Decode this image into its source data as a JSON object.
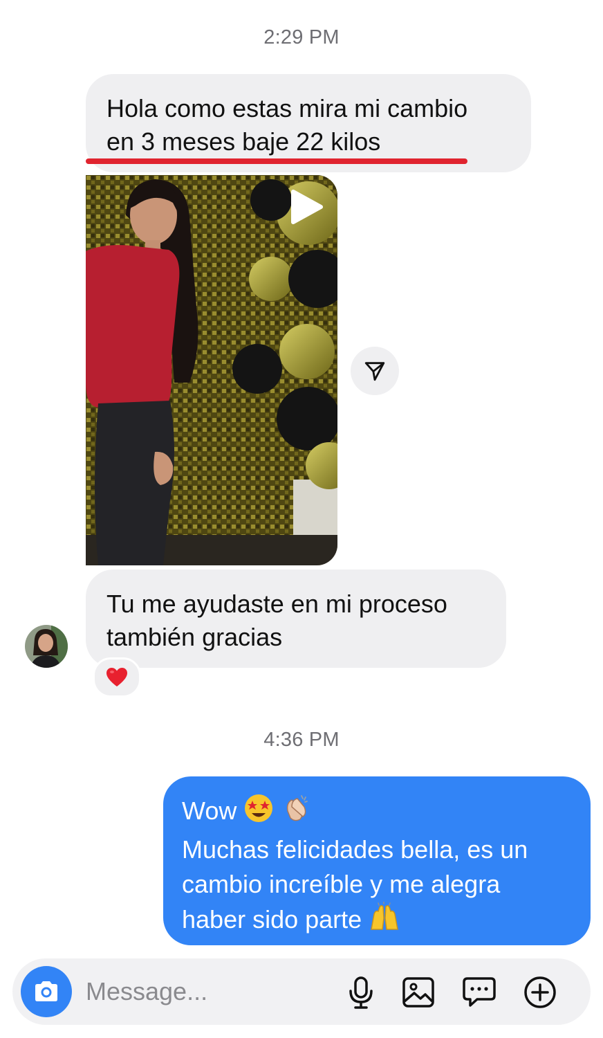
{
  "timestamps": {
    "first": "2:29 PM",
    "second": "4:36 PM"
  },
  "messages": {
    "incoming_1": {
      "line1": "Hola como estas mira mi cambio",
      "line2": "en 3 meses baje 22 kilos"
    },
    "incoming_2": {
      "line1": "Tu me ayudaste en mi proceso",
      "line2": "también gracias"
    },
    "incoming_2_reaction": "heart-emoji",
    "outgoing_1": {
      "line1": "Wow",
      "line2": "Muchas felicidades bella, es un",
      "line3": "cambio increíble y me alegra",
      "line4": "haber sido parte"
    }
  },
  "composer": {
    "placeholder": "Message..."
  },
  "icons": {
    "share": "paper-plane-icon",
    "play": "play-icon",
    "camera": "camera-icon",
    "mic": "microphone-icon",
    "gallery": "image-icon",
    "sticker": "sticker-chat-icon",
    "plus": "plus-circle-icon"
  },
  "colors": {
    "outgoing_bubble": "#3284f6",
    "incoming_bubble": "#efeff1",
    "underline": "#e0242f"
  }
}
